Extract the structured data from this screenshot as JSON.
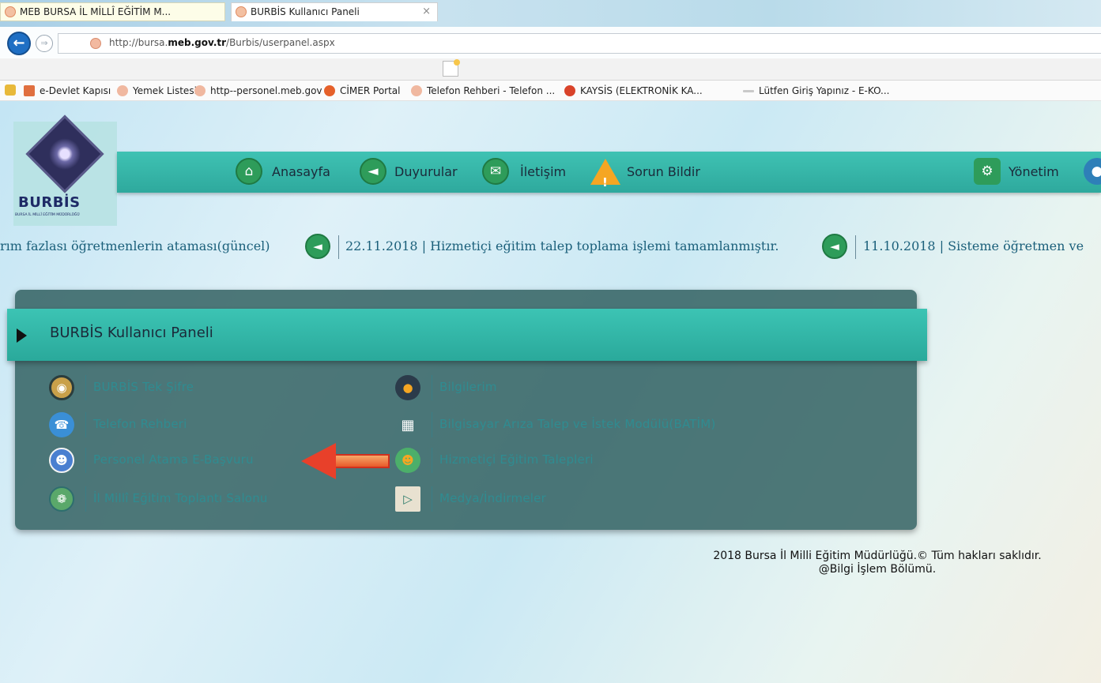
{
  "browser": {
    "url_prefix": "http://bursa.",
    "url_domain": "meb.gov.tr",
    "url_path": "/Burbis/userpanel.aspx",
    "tabs": [
      {
        "label": "MEB BURSA İL MİLLÎ EĞİTİM M..."
      },
      {
        "label": "BURBİS Kullanıcı Paneli",
        "close": "×"
      }
    ],
    "favorites": [
      {
        "label": "e-Devlet Kapısı"
      },
      {
        "label": "Yemek Listesi"
      },
      {
        "label": "http--personel.meb.gov"
      },
      {
        "label": "CİMER Portal"
      },
      {
        "label": "Telefon Rehberi - Telefon ..."
      },
      {
        "label": "KAYSİS (ELEKTRONİK KA..."
      },
      {
        "label": "Lütfen Giriş Yapınız - E-KO..."
      }
    ]
  },
  "logo": {
    "text": "BURBİS",
    "sub": "BURSA İL MİLLÎ EĞİTİM MÜDÜRLÜĞÜ"
  },
  "nav": {
    "items": [
      {
        "label": "Anasayfa",
        "icon": "home-icon"
      },
      {
        "label": "Duyurular",
        "icon": "megaphone-icon"
      },
      {
        "label": "İletişim",
        "icon": "envelope-icon"
      },
      {
        "label": "Sorun Bildir",
        "icon": "warning-icon"
      },
      {
        "label": "Yönetim",
        "icon": "settings-icon"
      }
    ]
  },
  "ticker": {
    "item1": "rım fazlası öğretmenlerin ataması(güncel)",
    "item2": "22.11.2018 | Hizmetiçi eğitim talep toplama işlemi tamamlanmıştır.",
    "item3": "11.10.2018 | Sisteme öğretmen ve"
  },
  "panel": {
    "title": "BURBİS Kullanıcı Paneli",
    "left_links": [
      {
        "label": "BURBİS Tek Şifre",
        "icon": "lock-gear-icon"
      },
      {
        "label": "Telefon Rehberi",
        "icon": "phone-icon"
      },
      {
        "label": "Personel Atama E-Başvuru",
        "icon": "person-icon"
      },
      {
        "label": "İl Millî Eğitim Toplantı Salonu",
        "icon": "meeting-icon"
      }
    ],
    "right_links": [
      {
        "label": "Bilgilerim",
        "icon": "user-icon"
      },
      {
        "label": "Bilgisayar Arıza Talep ve İstek Modülü(BATİM)",
        "icon": "computer-icon"
      },
      {
        "label": "Hizmetiçi Eğitim Talepleri",
        "icon": "teacher-icon"
      },
      {
        "label": "Medya/İndirmeler",
        "icon": "media-icon"
      }
    ]
  },
  "footer": {
    "line1": "2018 Bursa İl Milli Eğitim Müdürlüğü.© Tüm hakları saklıdır.",
    "line2": "@Bilgi İşlem Bölümü."
  },
  "colors": {
    "teal": "#34b5a8",
    "panel": "#2c5c5c",
    "arrow": "#e8402a"
  }
}
